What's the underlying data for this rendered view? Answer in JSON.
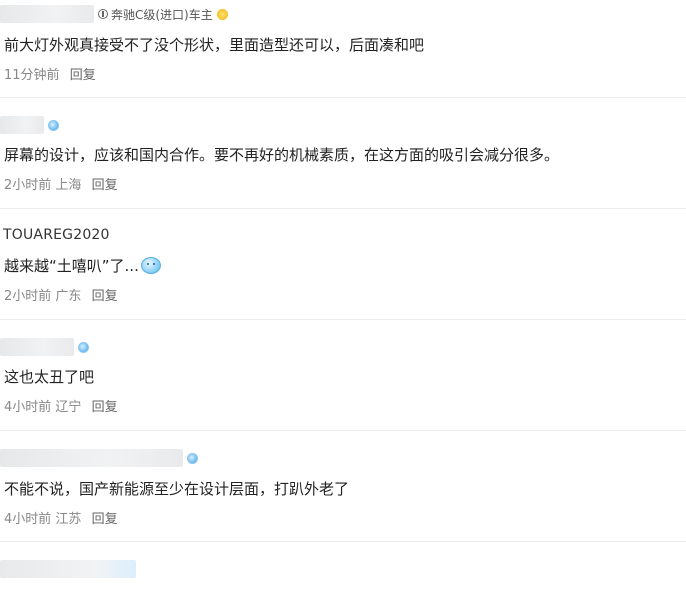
{
  "comments": [
    {
      "username": "",
      "car_badge": "奔驰C级(进口)车主",
      "content": "前大灯外观真接受不了没个形状，里面造型还可以，后面凑和吧",
      "time": "11分钟前",
      "location": "",
      "reply": "回复"
    },
    {
      "username": "",
      "content": "屏幕的设计，应该和国内合作。要不再好的机械素质，在这方面的吸引会减分很多。",
      "time": "2小时前",
      "location": "上海",
      "reply": "回复"
    },
    {
      "username": "TOUAREG2020",
      "content": "越来越“土嘻叭”了...",
      "time": "2小时前",
      "location": "广东",
      "reply": "回复"
    },
    {
      "username": "",
      "content": "这也太丑了吧",
      "time": "4小时前",
      "location": "辽宁",
      "reply": "回复"
    },
    {
      "username": "",
      "content": "不能不说，国产新能源至少在设计层面，打趴外老了",
      "time": "4小时前",
      "location": "江苏",
      "reply": "回复"
    }
  ],
  "colors": {
    "divider": "#ececec",
    "meta": "#888888",
    "badge": "#68b8ee"
  }
}
